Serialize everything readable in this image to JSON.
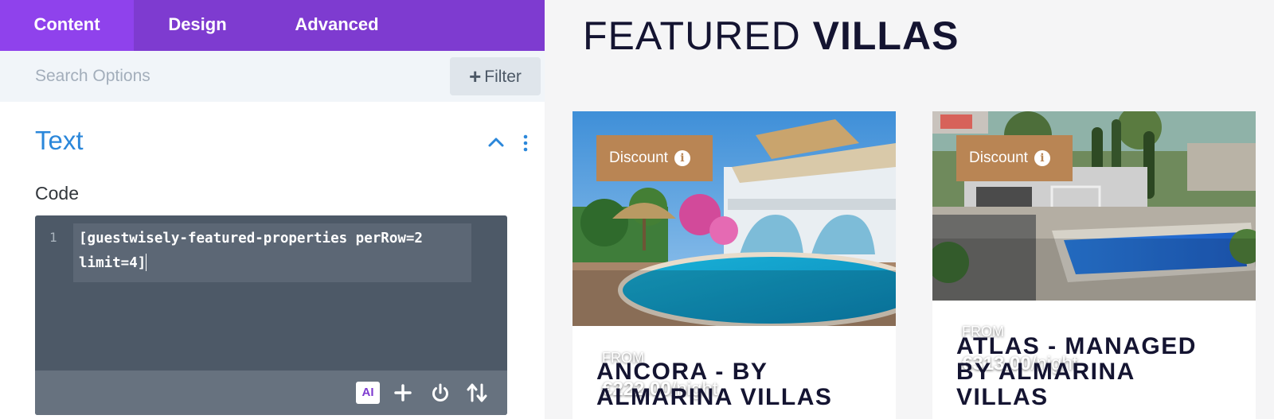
{
  "tabs": [
    {
      "label": "Content",
      "active": true
    },
    {
      "label": "Design",
      "active": false
    },
    {
      "label": "Advanced",
      "active": false
    }
  ],
  "search": {
    "placeholder": "Search Options",
    "value": ""
  },
  "filter": {
    "label": "Filter"
  },
  "section": {
    "title": "Text"
  },
  "code_field": {
    "label": "Code",
    "line_number": "1",
    "line_1": "[guestwisely-featured-properties perRow=2",
    "line_2": "limit=4]"
  },
  "toolbar": {
    "ai_label": "AI",
    "icons": [
      "ai-icon",
      "plus-icon",
      "power-icon",
      "sort-icon"
    ]
  },
  "preview": {
    "heading_light": "FEATURED ",
    "heading_bold": "VILLAS",
    "cards": [
      {
        "badge": "Discount",
        "from": "FROM",
        "price": "€222.00",
        "unit": "/night",
        "title_line_1": "ANCORA - BY",
        "title_line_2": "ALMARINA VILLAS",
        "title_line_3": ""
      },
      {
        "badge": "Discount",
        "from": "FROM",
        "price": "€313.00",
        "unit": "/night",
        "title_line_1": "ATLAS - MANAGED",
        "title_line_2": "BY ALMARINA",
        "title_line_3": "VILLAS"
      }
    ]
  },
  "colors": {
    "tab_bar": "#7e3bd0",
    "tab_active": "#8f42ec",
    "accent_blue": "#2b87da",
    "editor_bg": "#4d5967",
    "badge": "#b98554",
    "heading": "#141431"
  }
}
